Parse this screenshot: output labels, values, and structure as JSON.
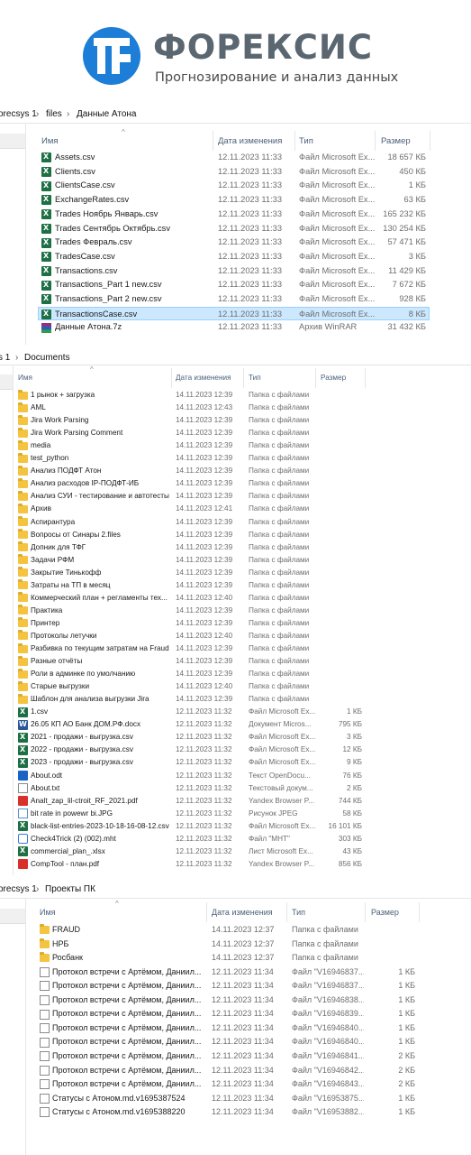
{
  "brand": {
    "name": "ФОРЕКСИС",
    "tagline": "Прогнозирование и анализ данных"
  },
  "panel1": {
    "breadcrumb": [
      "orecsys 1",
      "files",
      "Данные Атона"
    ],
    "columns": [
      "Имя",
      "Дата изменения",
      "Тип",
      "Размер"
    ],
    "rows": [
      {
        "icon": "excel-icon",
        "name": "Assets.csv",
        "date": "12.11.2023 11:33",
        "type": "Файл Microsoft Ex...",
        "size": "18 657 КБ"
      },
      {
        "icon": "excel-icon",
        "name": "Clients.csv",
        "date": "12.11.2023 11:33",
        "type": "Файл Microsoft Ex...",
        "size": "450 КБ"
      },
      {
        "icon": "excel-icon",
        "name": "ClientsCase.csv",
        "date": "12.11.2023 11:33",
        "type": "Файл Microsoft Ex...",
        "size": "1 КБ"
      },
      {
        "icon": "excel-icon",
        "name": "ExchangeRates.csv",
        "date": "12.11.2023 11:33",
        "type": "Файл Microsoft Ex...",
        "size": "63 КБ"
      },
      {
        "icon": "excel-icon",
        "name": "Trades Ноябрь Январь.csv",
        "date": "12.11.2023 11:33",
        "type": "Файл Microsoft Ex...",
        "size": "165 232 КБ"
      },
      {
        "icon": "excel-icon",
        "name": "Trades Сентябрь Октябрь.csv",
        "date": "12.11.2023 11:33",
        "type": "Файл Microsoft Ex...",
        "size": "130 254 КБ"
      },
      {
        "icon": "excel-icon",
        "name": "Trades Февраль.csv",
        "date": "12.11.2023 11:33",
        "type": "Файл Microsoft Ex...",
        "size": "57 471 КБ"
      },
      {
        "icon": "excel-icon",
        "name": "TradesCase.csv",
        "date": "12.11.2023 11:33",
        "type": "Файл Microsoft Ex...",
        "size": "3 КБ"
      },
      {
        "icon": "excel-icon",
        "name": "Transactions.csv",
        "date": "12.11.2023 11:33",
        "type": "Файл Microsoft Ex...",
        "size": "11 429 КБ"
      },
      {
        "icon": "excel-icon",
        "name": "Transactions_Part 1 new.csv",
        "date": "12.11.2023 11:33",
        "type": "Файл Microsoft Ex...",
        "size": "7 672 КБ"
      },
      {
        "icon": "excel-icon",
        "name": "Transactions_Part 2 new.csv",
        "date": "12.11.2023 11:33",
        "type": "Файл Microsoft Ex...",
        "size": "928 КБ"
      },
      {
        "icon": "excel-icon",
        "name": "TransactionsCase.csv",
        "date": "12.11.2023 11:33",
        "type": "Файл Microsoft Ex...",
        "size": "8 КБ",
        "selected": true
      },
      {
        "icon": "rar-icon",
        "name": "Данные Атона.7z",
        "date": "12.11.2023 11:33",
        "type": "Архив WinRAR",
        "size": "31 432 КБ"
      }
    ]
  },
  "panel2": {
    "breadcrumb": [
      "s 1",
      "Documents"
    ],
    "columns": [
      "Имя",
      "Дата изменения",
      "Тип",
      "Размер"
    ],
    "rows": [
      {
        "icon": "folder-icon",
        "name": "1 рынок + загрузка",
        "date": "14.11.2023 12:39",
        "type": "Папка с файлами",
        "size": ""
      },
      {
        "icon": "folder-icon",
        "name": "AML",
        "date": "14.11.2023 12:43",
        "type": "Папка с файлами",
        "size": ""
      },
      {
        "icon": "folder-icon",
        "name": "Jira Work Parsing",
        "date": "14.11.2023 12:39",
        "type": "Папка с файлами",
        "size": ""
      },
      {
        "icon": "folder-icon",
        "name": "Jira Work Parsing Comment",
        "date": "14.11.2023 12:39",
        "type": "Папка с файлами",
        "size": ""
      },
      {
        "icon": "folder-icon",
        "name": "media",
        "date": "14.11.2023 12:39",
        "type": "Папка с файлами",
        "size": ""
      },
      {
        "icon": "folder-icon",
        "name": "test_python",
        "date": "14.11.2023 12:39",
        "type": "Папка с файлами",
        "size": ""
      },
      {
        "icon": "folder-icon",
        "name": "Анализ ПОДФТ Атон",
        "date": "14.11.2023 12:39",
        "type": "Папка с файлами",
        "size": ""
      },
      {
        "icon": "folder-icon",
        "name": "Анализ расходов IP-ПОДФТ-ИБ",
        "date": "14.11.2023 12:39",
        "type": "Папка с файлами",
        "size": ""
      },
      {
        "icon": "folder-icon",
        "name": "Анализ СУИ - тестирование и автотесты",
        "date": "14.11.2023 12:39",
        "type": "Папка с файлами",
        "size": ""
      },
      {
        "icon": "folder-icon",
        "name": "Архив",
        "date": "14.11.2023 12:41",
        "type": "Папка с файлами",
        "size": ""
      },
      {
        "icon": "folder-icon",
        "name": "Аспирантура",
        "date": "14.11.2023 12:39",
        "type": "Папка с файлами",
        "size": ""
      },
      {
        "icon": "folder-icon",
        "name": "Вопросы от Синары 2.files",
        "date": "14.11.2023 12:39",
        "type": "Папка с файлами",
        "size": ""
      },
      {
        "icon": "folder-icon",
        "name": "Допник для ТФГ",
        "date": "14.11.2023 12:39",
        "type": "Папка с файлами",
        "size": ""
      },
      {
        "icon": "folder-icon",
        "name": "Задачи РФМ",
        "date": "14.11.2023 12:39",
        "type": "Папка с файлами",
        "size": ""
      },
      {
        "icon": "folder-icon",
        "name": "Закрытие Тинькофф",
        "date": "14.11.2023 12:39",
        "type": "Папка с файлами",
        "size": ""
      },
      {
        "icon": "folder-icon",
        "name": "Затраты на ТП в месяц",
        "date": "14.11.2023 12:39",
        "type": "Папка с файлами",
        "size": ""
      },
      {
        "icon": "folder-icon",
        "name": "Коммерческий план + регламенты тех...",
        "date": "14.11.2023 12:40",
        "type": "Папка с файлами",
        "size": ""
      },
      {
        "icon": "folder-icon",
        "name": "Практика",
        "date": "14.11.2023 12:39",
        "type": "Папка с файлами",
        "size": ""
      },
      {
        "icon": "folder-icon",
        "name": "Принтер",
        "date": "14.11.2023 12:39",
        "type": "Папка с файлами",
        "size": ""
      },
      {
        "icon": "folder-icon",
        "name": "Протоколы летучки",
        "date": "14.11.2023 12:40",
        "type": "Папка с файлами",
        "size": ""
      },
      {
        "icon": "folder-icon",
        "name": "Разбивка по текущим затратам на Fraud",
        "date": "14.11.2023 12:39",
        "type": "Папка с файлами",
        "size": ""
      },
      {
        "icon": "folder-icon",
        "name": "Разные отчёты",
        "date": "14.11.2023 12:39",
        "type": "Папка с файлами",
        "size": ""
      },
      {
        "icon": "folder-icon",
        "name": "Роли в админке по умолчанию",
        "date": "14.11.2023 12:39",
        "type": "Папка с файлами",
        "size": ""
      },
      {
        "icon": "folder-icon",
        "name": "Старые выгрузки",
        "date": "14.11.2023 12:40",
        "type": "Папка с файлами",
        "size": ""
      },
      {
        "icon": "folder-icon",
        "name": "Шаблон для анализа выгрузки Jira",
        "date": "14.11.2023 12:39",
        "type": "Папка с файлами",
        "size": ""
      },
      {
        "icon": "excel-icon",
        "name": "1.csv",
        "date": "12.11.2023 11:32",
        "type": "Файл Microsoft Ex...",
        "size": "1 КБ"
      },
      {
        "icon": "word-icon",
        "name": "26.05 КП АО Банк ДОМ.РФ.docx",
        "date": "12.11.2023 11:32",
        "type": "Документ Micros...",
        "size": "795 КБ"
      },
      {
        "icon": "excel-icon",
        "name": "2021 - продажи - выгрузка.csv",
        "date": "12.11.2023 11:32",
        "type": "Файл Microsoft Ex...",
        "size": "3 КБ"
      },
      {
        "icon": "excel-icon",
        "name": "2022 - продажи - выгрузка.csv",
        "date": "12.11.2023 11:32",
        "type": "Файл Microsoft Ex...",
        "size": "12 КБ"
      },
      {
        "icon": "excel-icon",
        "name": "2023 - продажи - выгрузка.csv",
        "date": "12.11.2023 11:32",
        "type": "Файл Microsoft Ex...",
        "size": "9 КБ"
      },
      {
        "icon": "odt-icon",
        "name": "About.odt",
        "date": "12.11.2023 11:32",
        "type": "Текст OpenDocu...",
        "size": "76 КБ"
      },
      {
        "icon": "text-file-icon",
        "name": "About.txt",
        "date": "12.11.2023 11:32",
        "type": "Текстовый докум...",
        "size": "2 КБ"
      },
      {
        "icon": "pdf-icon",
        "name": "Analt_zap_lil-ctroit_RF_2021.pdf",
        "date": "12.11.2023 11:32",
        "type": "Yandex Browser P...",
        "size": "744 КБ"
      },
      {
        "icon": "image-icon",
        "name": "bit rate in powewr bi.JPG",
        "date": "12.11.2023 11:32",
        "type": "Рисунок JPEG",
        "size": "58 КБ"
      },
      {
        "icon": "excel-icon",
        "name": "black-list-entries-2023-10-18-16-08-12.csv",
        "date": "12.11.2023 11:32",
        "type": "Файл Microsoft Ex...",
        "size": "16 101 КБ"
      },
      {
        "icon": "web-file-icon",
        "name": "Check4Trick (2) (002).mht",
        "date": "12.11.2023 11:32",
        "type": "Файл \"MHT\"",
        "size": "303 КБ"
      },
      {
        "icon": "excel-icon",
        "name": "commercial_plan_.xlsx",
        "date": "12.11.2023 11:32",
        "type": "Лист Microsoft Ex...",
        "size": "43 КБ"
      },
      {
        "icon": "pdf-icon",
        "name": "CompTool - план.pdf",
        "date": "12.11.2023 11:32",
        "type": "Yandex Browser P...",
        "size": "856 КБ"
      }
    ]
  },
  "panel3": {
    "breadcrumb": [
      "orecsys 1",
      "Проекты ПК"
    ],
    "columns": [
      "Имя",
      "Дата изменения",
      "Тип",
      "Размер"
    ],
    "rows": [
      {
        "icon": "folder-icon",
        "name": "FRAUD",
        "date": "14.11.2023 12:37",
        "type": "Папка с файлами",
        "size": ""
      },
      {
        "icon": "folder-icon",
        "name": "НРБ",
        "date": "14.11.2023 12:37",
        "type": "Папка с файлами",
        "size": ""
      },
      {
        "icon": "folder-icon",
        "name": "Росбанк",
        "date": "14.11.2023 12:37",
        "type": "Папка с файлами",
        "size": ""
      },
      {
        "icon": "text-file-icon",
        "name": "Протокол встречи с Артёмом, Даниил...",
        "date": "12.11.2023 11:34",
        "type": "Файл \"V16946837...",
        "size": "1 КБ"
      },
      {
        "icon": "text-file-icon",
        "name": "Протокол встречи с Артёмом, Даниил...",
        "date": "12.11.2023 11:34",
        "type": "Файл \"V16946837...",
        "size": "1 КБ"
      },
      {
        "icon": "text-file-icon",
        "name": "Протокол встречи с Артёмом, Даниил...",
        "date": "12.11.2023 11:34",
        "type": "Файл \"V16946838...",
        "size": "1 КБ"
      },
      {
        "icon": "text-file-icon",
        "name": "Протокол встречи с Артёмом, Даниил...",
        "date": "12.11.2023 11:34",
        "type": "Файл \"V16946839...",
        "size": "1 КБ"
      },
      {
        "icon": "text-file-icon",
        "name": "Протокол встречи с Артёмом, Даниил...",
        "date": "12.11.2023 11:34",
        "type": "Файл \"V16946840...",
        "size": "1 КБ"
      },
      {
        "icon": "text-file-icon",
        "name": "Протокол встречи с Артёмом, Даниил...",
        "date": "12.11.2023 11:34",
        "type": "Файл \"V16946840...",
        "size": "1 КБ"
      },
      {
        "icon": "text-file-icon",
        "name": "Протокол встречи с Артёмом, Даниил...",
        "date": "12.11.2023 11:34",
        "type": "Файл \"V16946841...",
        "size": "2 КБ"
      },
      {
        "icon": "text-file-icon",
        "name": "Протокол встречи с Артёмом, Даниил...",
        "date": "12.11.2023 11:34",
        "type": "Файл \"V16946842...",
        "size": "2 КБ"
      },
      {
        "icon": "text-file-icon",
        "name": "Протокол встречи с Артёмом, Даниил...",
        "date": "12.11.2023 11:34",
        "type": "Файл \"V16946843...",
        "size": "2 КБ"
      },
      {
        "icon": "text-file-icon",
        "name": "Статусы с Атоном.md.v1695387524",
        "date": "12.11.2023 11:34",
        "type": "Файл \"V16953875...",
        "size": "1 КБ"
      },
      {
        "icon": "text-file-icon",
        "name": "Статусы с Атоном.md.v1695388220",
        "date": "12.11.2023 11:34",
        "type": "Файл \"V16953882...",
        "size": "1 КБ"
      }
    ]
  }
}
